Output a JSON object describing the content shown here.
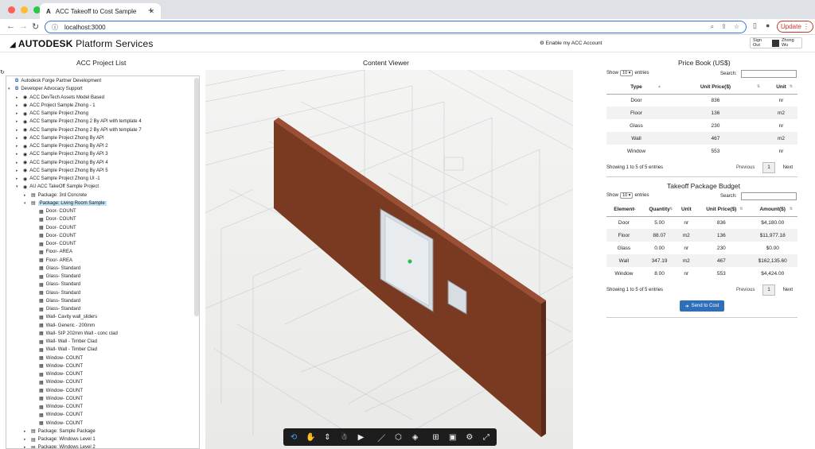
{
  "browser": {
    "tab_title": "ACC Takeoff to Cost Sample",
    "url": "localhost:3000",
    "update_label": "Update",
    "colors": {
      "close": "#ff5f57",
      "min": "#febc2e",
      "max": "#28c840"
    }
  },
  "header": {
    "brand_bold": "AUTODESK",
    "brand_rest": " Platform Services",
    "enable_link": "⚙ Enable my ACC Account",
    "signout_label": "Sign Out",
    "user_name": "Zhong Wu"
  },
  "left": {
    "title": "ACC Project List",
    "tree": [
      {
        "label": "Autodesk Forge Partner Development",
        "level": 0,
        "icon": "hub-icon",
        "twisty": ""
      },
      {
        "label": "Developer Advocacy Support",
        "level": 0,
        "icon": "hub-icon",
        "twisty": "▾"
      },
      {
        "label": "ACC DevTech Assets Model Based",
        "level": 1,
        "icon": "project-icon",
        "twisty": "▸"
      },
      {
        "label": "ACC Project Sample Zhong - 1",
        "level": 1,
        "icon": "project-icon",
        "twisty": "▸"
      },
      {
        "label": "ACC Sample Project Zhong",
        "level": 1,
        "icon": "project-icon",
        "twisty": "▸"
      },
      {
        "label": "ACC Sample Project Zhong 2 By API with template 4",
        "level": 1,
        "icon": "project-icon",
        "twisty": "▸"
      },
      {
        "label": "ACC Sample Project Zhong 2 By API with template 7",
        "level": 1,
        "icon": "project-icon",
        "twisty": "▸"
      },
      {
        "label": "ACC Sample Project Zhong By API",
        "level": 1,
        "icon": "project-icon",
        "twisty": "▸"
      },
      {
        "label": "ACC Sample Project Zhong By API 2",
        "level": 1,
        "icon": "project-icon",
        "twisty": "▸"
      },
      {
        "label": "ACC Sample Project Zhong By API 3",
        "level": 1,
        "icon": "project-icon",
        "twisty": "▸"
      },
      {
        "label": "ACC Sample Project Zhong By API 4",
        "level": 1,
        "icon": "project-icon",
        "twisty": "▸"
      },
      {
        "label": "ACC Sample Project Zhong By API 5",
        "level": 1,
        "icon": "project-icon",
        "twisty": "▸"
      },
      {
        "label": "ACC Sample Project Zhong UI -1",
        "level": 1,
        "icon": "project-icon",
        "twisty": "▸"
      },
      {
        "label": "AU ACC TakeOff Sample Project",
        "level": 1,
        "icon": "project-icon",
        "twisty": "▾"
      },
      {
        "label": "Package: 3rd Concrete",
        "level": 2,
        "icon": "package-icon",
        "twisty": "▸"
      },
      {
        "label": "Package: Living Room Sample",
        "level": 2,
        "icon": "package-icon",
        "twisty": "▾",
        "selected": true
      },
      {
        "label": "Door- COUNT",
        "level": 3,
        "icon": "item-icon",
        "twisty": ""
      },
      {
        "label": "Door- COUNT",
        "level": 3,
        "icon": "item-icon",
        "twisty": ""
      },
      {
        "label": "Door- COUNT",
        "level": 3,
        "icon": "item-icon",
        "twisty": ""
      },
      {
        "label": "Door- COUNT",
        "level": 3,
        "icon": "item-icon",
        "twisty": ""
      },
      {
        "label": "Door- COUNT",
        "level": 3,
        "icon": "item-icon",
        "twisty": ""
      },
      {
        "label": "Floor- AREA",
        "level": 3,
        "icon": "item-icon",
        "twisty": ""
      },
      {
        "label": "Floor- AREA",
        "level": 3,
        "icon": "item-icon",
        "twisty": ""
      },
      {
        "label": "Glass- Standard",
        "level": 3,
        "icon": "item-icon",
        "twisty": ""
      },
      {
        "label": "Glass- Standard",
        "level": 3,
        "icon": "item-icon",
        "twisty": ""
      },
      {
        "label": "Glass- Standard",
        "level": 3,
        "icon": "item-icon",
        "twisty": ""
      },
      {
        "label": "Glass- Standard",
        "level": 3,
        "icon": "item-icon",
        "twisty": ""
      },
      {
        "label": "Glass- Standard",
        "level": 3,
        "icon": "item-icon",
        "twisty": ""
      },
      {
        "label": "Glass- Standard",
        "level": 3,
        "icon": "item-icon",
        "twisty": ""
      },
      {
        "label": "Wall- Cavity wall_sliders",
        "level": 3,
        "icon": "item-icon",
        "twisty": ""
      },
      {
        "label": "Wall- Generic - 200mm",
        "level": 3,
        "icon": "item-icon",
        "twisty": ""
      },
      {
        "label": "Wall- SIP 202mm Wall - conc clad",
        "level": 3,
        "icon": "item-icon",
        "twisty": ""
      },
      {
        "label": "Wall- Wall - Timber Clad",
        "level": 3,
        "icon": "item-icon",
        "twisty": ""
      },
      {
        "label": "Wall- Wall - Timber Clad",
        "level": 3,
        "icon": "item-icon",
        "twisty": ""
      },
      {
        "label": "Window- COUNT",
        "level": 3,
        "icon": "item-icon",
        "twisty": ""
      },
      {
        "label": "Window- COUNT",
        "level": 3,
        "icon": "item-icon",
        "twisty": ""
      },
      {
        "label": "Window- COUNT",
        "level": 3,
        "icon": "item-icon",
        "twisty": ""
      },
      {
        "label": "Window- COUNT",
        "level": 3,
        "icon": "item-icon",
        "twisty": ""
      },
      {
        "label": "Window- COUNT",
        "level": 3,
        "icon": "item-icon",
        "twisty": ""
      },
      {
        "label": "Window- COUNT",
        "level": 3,
        "icon": "item-icon",
        "twisty": ""
      },
      {
        "label": "Window- COUNT",
        "level": 3,
        "icon": "item-icon",
        "twisty": ""
      },
      {
        "label": "Window- COUNT",
        "level": 3,
        "icon": "item-icon",
        "twisty": ""
      },
      {
        "label": "Window- COUNT",
        "level": 3,
        "icon": "item-icon",
        "twisty": ""
      },
      {
        "label": "Package: Sample Package",
        "level": 2,
        "icon": "package-icon",
        "twisty": "▸"
      },
      {
        "label": "Package: Windows Level 1",
        "level": 2,
        "icon": "package-icon",
        "twisty": "▸"
      },
      {
        "label": "Package: Windows Level 2",
        "level": 2,
        "icon": "package-icon",
        "twisty": "▸"
      }
    ]
  },
  "center": {
    "title": "Content Viewer",
    "wall_color": "#7a3a22",
    "toolbar": [
      "orbit-icon",
      "pan-icon",
      "zoom-icon",
      "first-person-icon",
      "camera-icon",
      "measure-icon",
      "section-icon",
      "explode-icon",
      "model-browser-icon",
      "properties-icon",
      "settings-icon",
      "fullscreen-icon"
    ]
  },
  "pricebook": {
    "title": "Price Book (US$)",
    "show": "Show",
    "entries": "entries",
    "page_size": "10",
    "search": "Search:",
    "headers": [
      "Type",
      "Unit Price($)",
      "Unit"
    ],
    "rows": [
      [
        "Door",
        "836",
        "nr"
      ],
      [
        "Floor",
        "136",
        "m2"
      ],
      [
        "Glass",
        "230",
        "nr"
      ],
      [
        "Wall",
        "467",
        "m2"
      ],
      [
        "Window",
        "553",
        "nr"
      ]
    ],
    "info": "Showing 1 to 5 of 5 entries",
    "prev": "Previous",
    "page": "1",
    "next": "Next"
  },
  "budget": {
    "title": "Takeoff Package Budget",
    "show": "Show",
    "entries": "entries",
    "page_size": "10",
    "search": "Search:",
    "headers": [
      "Element",
      "Quantity",
      "Unit",
      "Unit Price($)",
      "Amount($)"
    ],
    "rows": [
      [
        "Door",
        "5.00",
        "nr",
        "836",
        "$4,180.00"
      ],
      [
        "Floor",
        "88.07",
        "m2",
        "136",
        "$11,977.18"
      ],
      [
        "Glass",
        "0.00",
        "nr",
        "230",
        "$0.00"
      ],
      [
        "Wall",
        "347.19",
        "m2",
        "467",
        "$162,135.60"
      ],
      [
        "Window",
        "8.00",
        "nr",
        "553",
        "$4,424.00"
      ]
    ],
    "info": "Showing 1 to 5 of 5 entries",
    "prev": "Previous",
    "page": "1",
    "next": "Next",
    "send_label": "Send to Cost",
    "accent": "#2e6fb8"
  }
}
